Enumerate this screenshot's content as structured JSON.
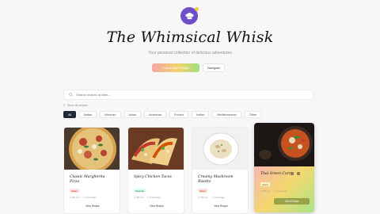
{
  "header": {
    "title": "The Whimsical Whisk",
    "subtitle": "Your personal collection of delicious adventures",
    "primary_button": "+ Add New Recipe",
    "secondary_button": "Navigate"
  },
  "search": {
    "placeholder": "Search recipes or titles..."
  },
  "filters": {
    "toggle_label": "Show all recipes",
    "categories": [
      "All",
      "Italian",
      "Mexican",
      "Asian",
      "American",
      "French",
      "Indian",
      "Mediterranean",
      "Other"
    ],
    "active_index": 0
  },
  "recipes": [
    {
      "name": "Classic Margherita Pizza",
      "tag": "Italian",
      "time": "30 min",
      "servings": "4 servings",
      "action": "View Recipe",
      "tag_color": "#fde2e2",
      "tag_text_color": "#c2410c"
    },
    {
      "name": "Spicy Chicken Tacos",
      "tag": "Mexican",
      "time": "25 min",
      "servings": "3 servings",
      "action": "View Recipe",
      "tag_color": "#dcfce7",
      "tag_text_color": "#15803d"
    },
    {
      "name": "Creamy Mushroom Risotto",
      "tag": "Italian",
      "time": "40 min",
      "servings": "2 servings",
      "action": "View Recipe",
      "tag_color": "#fde2e2",
      "tag_text_color": "#c2410c"
    },
    {
      "name": "Thai Green Curry",
      "tag": "Asian",
      "time": "35 min",
      "servings": "4 servings",
      "action": "View Recipe",
      "tag_color": "#fef3c7",
      "tag_text_color": "#92400e"
    }
  ],
  "colors": {
    "brand": "#6d4fc9",
    "accent_yellow": "#f3c94c",
    "dark_chip": "#1f2937"
  }
}
